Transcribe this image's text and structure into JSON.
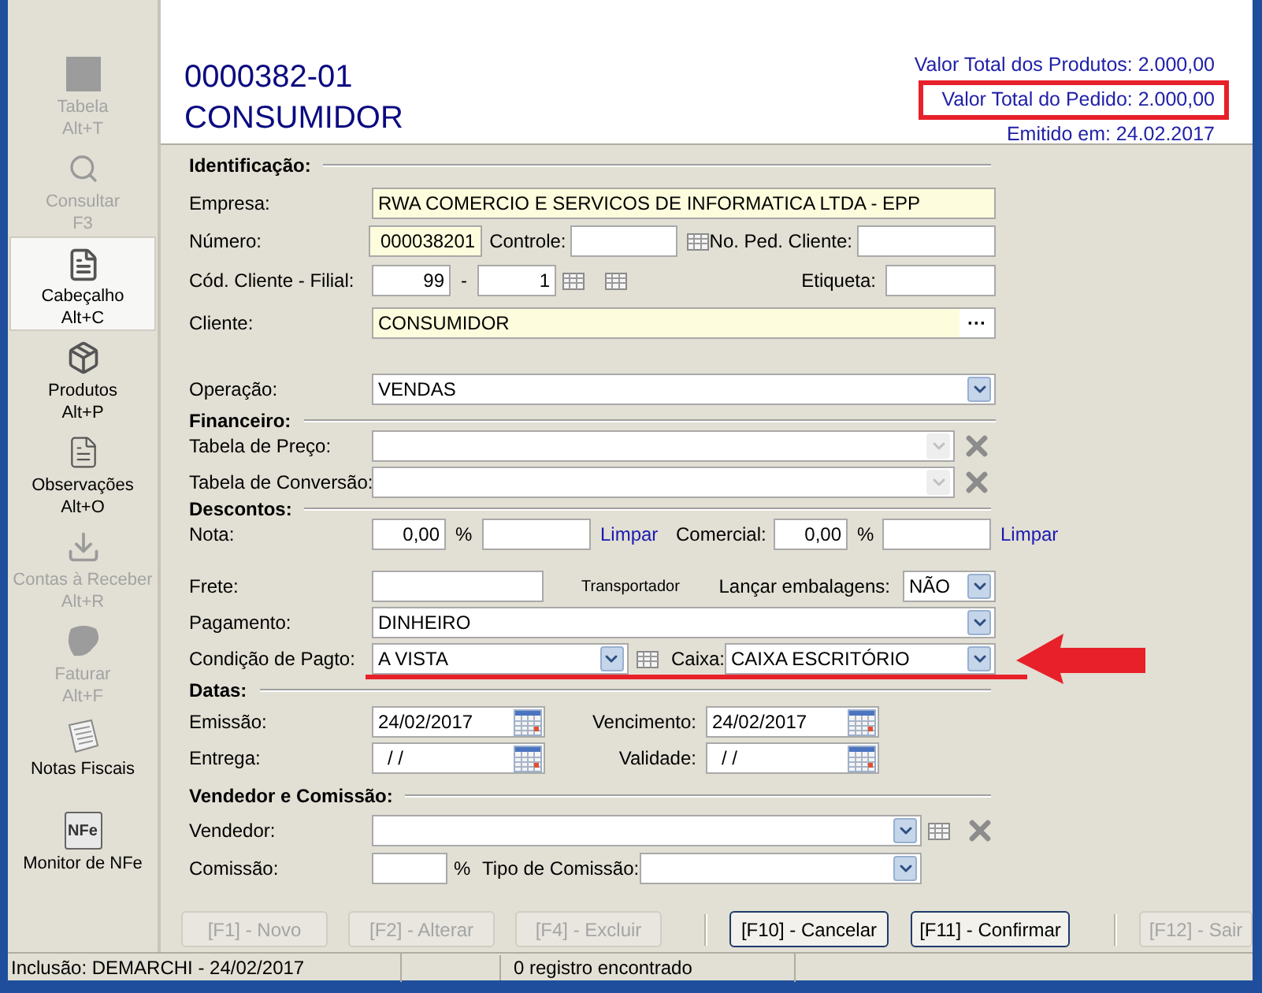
{
  "sidebar": {
    "items": [
      {
        "label": "Tabela",
        "shortcut": "Alt+T",
        "disabled": true,
        "selected": false
      },
      {
        "label": "Consultar",
        "shortcut": "F3",
        "disabled": true,
        "selected": false
      },
      {
        "label": "Cabeçalho",
        "shortcut": "Alt+C",
        "disabled": false,
        "selected": true
      },
      {
        "label": "Produtos",
        "shortcut": "Alt+P",
        "disabled": false,
        "selected": false
      },
      {
        "label": "Observações",
        "shortcut": "Alt+O",
        "disabled": false,
        "selected": false
      },
      {
        "label": "Contas à Receber",
        "shortcut": "Alt+R",
        "disabled": true,
        "selected": false
      },
      {
        "label": "Faturar",
        "shortcut": "Alt+F",
        "disabled": true,
        "selected": false
      },
      {
        "label": "Notas Fiscais",
        "disabled": false,
        "selected": false
      },
      {
        "label": "Monitor de NFe",
        "icon_text": "NFe",
        "disabled": false,
        "selected": false
      }
    ]
  },
  "header": {
    "order_number": "0000382-01",
    "customer": "CONSUMIDOR",
    "totals": [
      "Valor Total dos Produtos: 2.000,00",
      "Valor Total do Pedido: 2.000,00",
      "Emitido em: 24.02.2017"
    ]
  },
  "identificacao": {
    "title": "Identificação:",
    "empresa": {
      "label": "Empresa:",
      "value": "RWA COMERCIO E SERVICOS DE INFORMATICA LTDA - EPP",
      "readonly": true
    },
    "numero": {
      "label": "Número:",
      "value": "000038201",
      "readonly": true
    },
    "controle": {
      "label": "Controle:"
    },
    "no_ped_cliente": {
      "label": "No. Ped. Cliente:"
    },
    "cod_cliente": {
      "label": "Cód. Cliente - Filial:",
      "value": "99"
    },
    "separator": "-",
    "filial": {
      "value": "1"
    },
    "etiqueta": {
      "label": "Etiqueta:"
    },
    "cliente": {
      "label": "Cliente:",
      "value": "CONSUMIDOR",
      "readonly": true,
      "button": "···"
    }
  },
  "operacao": {
    "label": "Operação:",
    "value": "VENDAS",
    "disabled": false
  },
  "financeiro": {
    "title": "Financeiro:",
    "tabela_preco": {
      "label": "Tabela de Preço:",
      "disabled": true
    },
    "tabela_conversao": {
      "label": "Tabela de Conversão:",
      "disabled": true
    }
  },
  "descontos": {
    "title": "Descontos:",
    "nota": {
      "label": "Nota:",
      "value": "0,00",
      "percent": "%",
      "link": "Limpar"
    },
    "comercial": {
      "label": "Comercial:",
      "value": "0,00",
      "percent": "%",
      "link": "Limpar"
    }
  },
  "frete": {
    "label": "Frete:"
  },
  "transportador": {
    "label": "Transportador"
  },
  "lancar_embalagens": {
    "label": "Lançar embalagens:",
    "value": "NÃO",
    "disabled": false
  },
  "pagamento": {
    "label": "Pagamento:",
    "value": "DINHEIRO",
    "disabled": false
  },
  "condicao_pagto": {
    "label": "Condição de Pagto:",
    "value": "A VISTA",
    "disabled": false
  },
  "caixa": {
    "label": "Caixa:",
    "value": "CAIXA ESCRITÓRIO",
    "disabled": false
  },
  "datas": {
    "title": "Datas:",
    "emissao": {
      "label": "Emissão:",
      "value": "24/02/2017"
    },
    "vencimento": {
      "label": "Vencimento:",
      "value": "24/02/2017"
    },
    "entrega": {
      "label": "Entrega:",
      "value": "/ /"
    },
    "validade": {
      "label": "Validade:",
      "value": "/ /"
    }
  },
  "vendedor_comissao": {
    "title": "Vendedor e Comissão:",
    "vendedor": {
      "label": "Vendedor:",
      "disabled": false
    },
    "comissao": {
      "label": "Comissão:",
      "percent": "%"
    },
    "tipo_comissao": {
      "label": "Tipo de Comissão:",
      "disabled": false
    }
  },
  "buttons": [
    {
      "label": "[F1] - Novo",
      "disabled": true
    },
    {
      "label": "[F2] - Alterar",
      "disabled": true
    },
    {
      "label": "[F4] - Excluir",
      "disabled": true
    },
    {
      "label": "[F10] - Cancelar",
      "disabled": false
    },
    {
      "label": "[F11] - Confirmar",
      "disabled": false
    },
    {
      "label": "[F12] - Sair",
      "disabled": true
    }
  ],
  "status_bar": [
    "Inclusão: DEMARCHI - 24/02/2017",
    "0 registro encontrado"
  ]
}
